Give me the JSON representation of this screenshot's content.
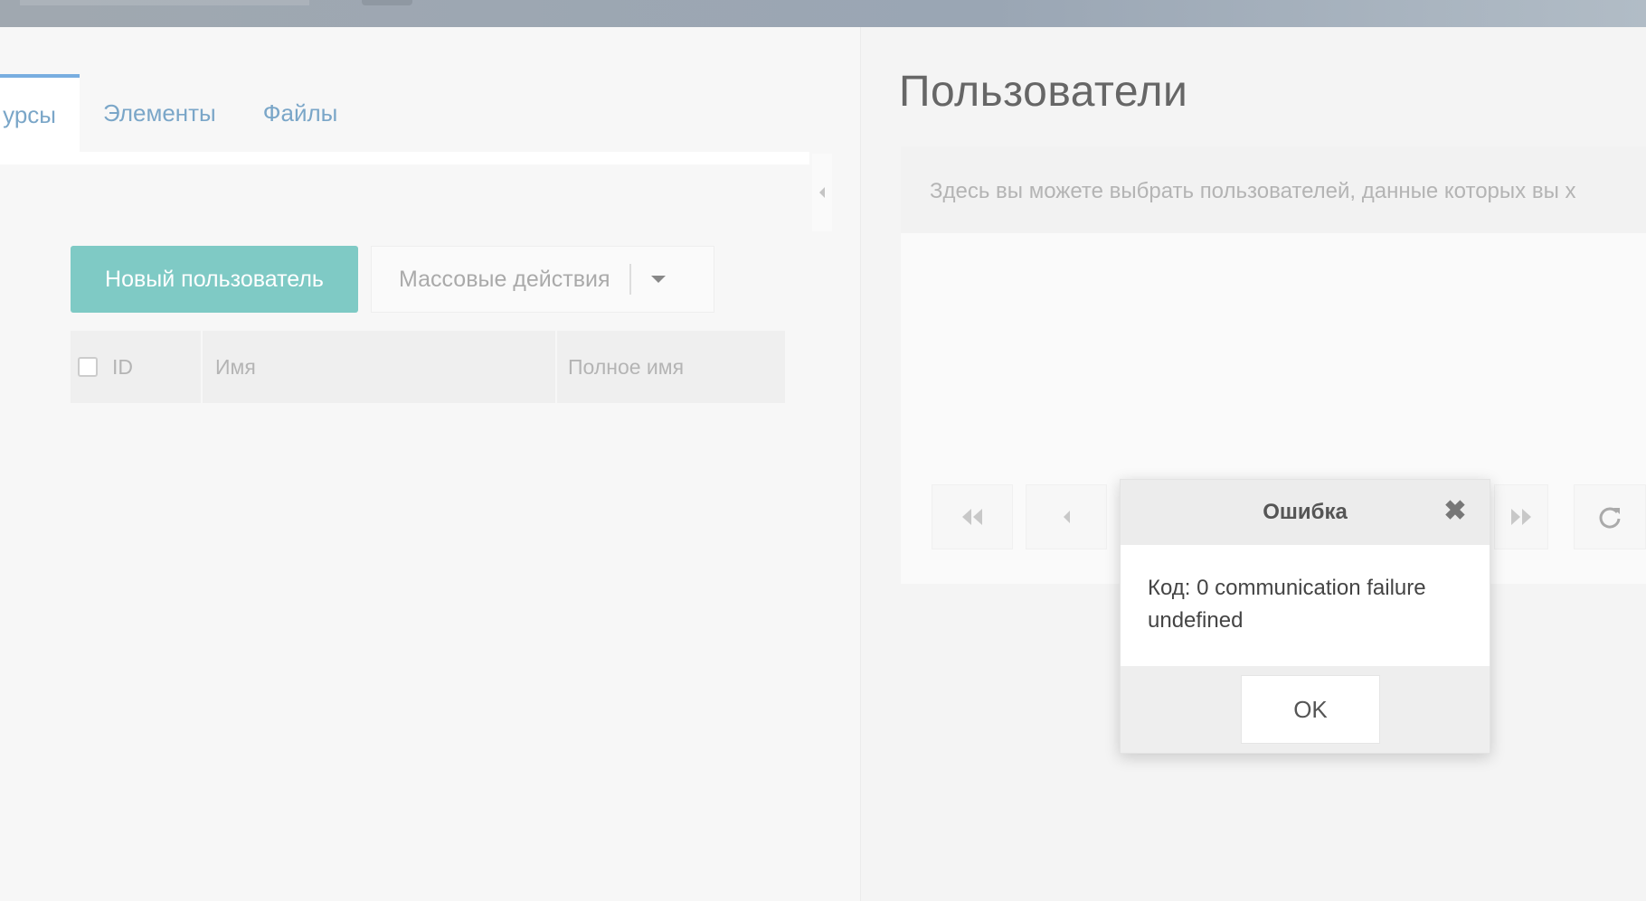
{
  "left_panel": {
    "tabs": [
      {
        "label": "урсы",
        "active": true
      },
      {
        "label": "Элементы",
        "active": false
      },
      {
        "label": "Файлы",
        "active": false
      }
    ]
  },
  "main": {
    "title": "Пользователи",
    "description": "Здесь вы можете выбрать пользователей, данные которых вы х",
    "toolbar": {
      "new_user_label": "Новый пользователь",
      "mass_actions_label": "Массовые действия"
    },
    "table": {
      "columns": [
        "ID",
        "Имя",
        "Полное имя"
      ]
    }
  },
  "modal": {
    "title": "Ошибка",
    "close_glyph": "✖",
    "message_line1": "Код: 0 communication failure",
    "message_line2": "undefined",
    "ok_label": "OK"
  },
  "colors": {
    "accent": "#7fcac5",
    "tab_link": "#7aa6c8"
  },
  "icons": {
    "first_page": "double-chevron-left-icon",
    "prev_page": "chevron-left-icon",
    "last_page": "double-chevron-right-icon",
    "refresh": "refresh-icon"
  }
}
